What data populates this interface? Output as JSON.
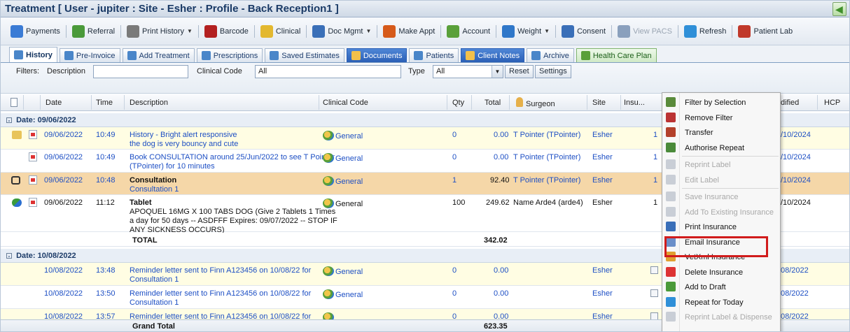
{
  "window": {
    "title": "Treatment [ User - jupiter : Site - Esher : Profile - Back Reception1 ]"
  },
  "toolbar": {
    "items": [
      {
        "label": "Payments",
        "icon": "payments-icon",
        "color": "#3a7bd5",
        "dropdown": false,
        "disabled": false
      },
      {
        "label": "Referral",
        "icon": "referral-icon",
        "color": "#4a9a3a",
        "dropdown": false,
        "disabled": false
      },
      {
        "label": "Print History",
        "icon": "print-history-icon",
        "color": "#7a7a7a",
        "dropdown": true,
        "disabled": false
      },
      {
        "label": "Barcode",
        "icon": "barcode-icon",
        "color": "#b32020",
        "dropdown": false,
        "disabled": false
      },
      {
        "label": "Clinical",
        "icon": "clinical-icon",
        "color": "#e3b82f",
        "dropdown": false,
        "disabled": false
      },
      {
        "label": "Doc Mgmt",
        "icon": "doc-mgmt-icon",
        "color": "#3a6fb8",
        "dropdown": true,
        "disabled": false
      },
      {
        "label": "Make Appt",
        "icon": "calendar-icon",
        "color": "#d65a1a",
        "dropdown": false,
        "disabled": false
      },
      {
        "label": "Account",
        "icon": "account-icon",
        "color": "#5aa03a",
        "dropdown": false,
        "disabled": false
      },
      {
        "label": "Weight",
        "icon": "weight-chart-icon",
        "color": "#2f77c9",
        "dropdown": true,
        "disabled": false
      },
      {
        "label": "Consent",
        "icon": "consent-icon",
        "color": "#3a6fb8",
        "dropdown": false,
        "disabled": false
      },
      {
        "label": "View PACS",
        "icon": "view-pacs-icon",
        "color": "#8aa0bd",
        "dropdown": false,
        "disabled": true
      },
      {
        "label": "Refresh",
        "icon": "refresh-icon",
        "color": "#2f8fd8",
        "dropdown": false,
        "disabled": false
      },
      {
        "label": "Patient Lab",
        "icon": "patient-lab-icon",
        "color": "#c0392b",
        "dropdown": false,
        "disabled": false
      }
    ]
  },
  "tabs": [
    {
      "label": "History",
      "style": "active",
      "icon": "history-tab-icon"
    },
    {
      "label": "Pre-Invoice",
      "style": "normal",
      "icon": "pre-invoice-tab-icon"
    },
    {
      "label": "Add Treatment",
      "style": "normal",
      "icon": "add-treatment-tab-icon"
    },
    {
      "label": "Prescriptions",
      "style": "normal",
      "icon": "prescriptions-tab-icon"
    },
    {
      "label": "Saved Estimates",
      "style": "normal",
      "icon": "saved-estimates-tab-icon"
    },
    {
      "label": "Documents",
      "style": "blue",
      "icon": "documents-tab-icon"
    },
    {
      "label": "Patients",
      "style": "normal",
      "icon": "patients-tab-icon"
    },
    {
      "label": "Client Notes",
      "style": "blue",
      "icon": "client-notes-tab-icon"
    },
    {
      "label": "Archive",
      "style": "normal",
      "icon": "archive-tab-icon"
    },
    {
      "label": "Health Care Plan",
      "style": "green",
      "icon": "health-care-plan-tab-icon"
    }
  ],
  "filters": {
    "label": "Filters:",
    "description_label": "Description",
    "description_value": "",
    "clinical_code_label": "Clinical Code",
    "clinical_code_value": "All",
    "type_label": "Type",
    "type_value": "All",
    "reset_label": "Reset",
    "settings_label": "Settings"
  },
  "columns": {
    "date": "Date",
    "time": "Time",
    "description": "Description",
    "clinical_code": "Clinical Code",
    "qty": "Qty",
    "total": "Total",
    "surgeon": "Surgeon",
    "site": "Site",
    "insurance": "Insu...",
    "modified": "dified",
    "hcp": "HCP"
  },
  "groups": [
    {
      "label": "Date: 09/06/2022",
      "rows": [
        {
          "date": "09/06/2022",
          "time": "10:49",
          "desc1": "History - Bright alert responsive",
          "desc2": "the dog is very bouncy and cute",
          "desc3": "",
          "desc4": "",
          "code": "General",
          "qty": "0",
          "total": "0.00",
          "surgeon": "T Pointer (TPointer)",
          "site": "Esher",
          "ins": "1",
          "mod": "/10/2024"
        },
        {
          "date": "09/06/2022",
          "time": "10:49",
          "desc1": "Book CONSULTATION around 25/Jun/2022 to see T Pointer",
          "desc2": "(TPointer) for 10 minutes",
          "desc3": "",
          "desc4": "",
          "code": "General",
          "qty": "0",
          "total": "0.00",
          "surgeon": "T Pointer (TPointer)",
          "site": "Esher",
          "ins": "1",
          "mod": "/10/2024"
        },
        {
          "date": "09/06/2022",
          "time": "10:48",
          "desc1": "Consultation",
          "desc2": "Consultation 1",
          "desc3": "",
          "desc4": "",
          "code": "General",
          "qty": "1",
          "total": "92.40",
          "surgeon": "T Pointer (TPointer)",
          "site": "Esher",
          "ins": "1",
          "mod": "/10/2024"
        },
        {
          "date": "09/06/2022",
          "time": "11:12",
          "desc1": "Tablet",
          "desc2": "APOQUEL 16MG X 100 TABS DOG (Give 2 Tablets 1 Times",
          "desc3": "a day for 50 days -- ASDFFF Expires: 09/07/2022 -- STOP IF",
          "desc4": "ANY SICKNESS OCCURS)",
          "code": "General",
          "qty": "100",
          "total": "249.62",
          "surgeon": "Name Arde4 (arde4)",
          "site": "Esher",
          "ins": "1",
          "mod": "/10/2024"
        }
      ],
      "total_label": "TOTAL",
      "total_value": "342.02"
    },
    {
      "label": "Date: 10/08/2022",
      "rows": [
        {
          "date": "10/08/2022",
          "time": "13:48",
          "desc1": "Reminder letter sent to Finn A123456 on 10/08/22 for",
          "desc2": "Consultation 1",
          "code": "General",
          "qty": "0",
          "total": "0.00",
          "site": "Esher",
          "mod": "08/2022"
        },
        {
          "date": "10/08/2022",
          "time": "13:50",
          "desc1": "Reminder letter sent to Finn A123456 on 10/08/22 for",
          "desc2": "Consultation 1",
          "code": "General",
          "qty": "0",
          "total": "0.00",
          "site": "Esher",
          "mod": "08/2022"
        },
        {
          "date": "10/08/2022",
          "time": "13:57",
          "desc1": "Reminder letter sent to Finn A123456 on 10/08/22 for",
          "desc2": "",
          "code": "",
          "qty": "0",
          "total": "0.00",
          "site": "Esher",
          "mod": "08/2022"
        }
      ]
    }
  ],
  "grand_total": {
    "label": "Grand Total",
    "value": "623.35"
  },
  "context_menu": [
    {
      "label": "Filter by Selection",
      "icon": "filter-selection-icon",
      "color": "#5a8a3a",
      "disabled": false
    },
    {
      "label": "Remove Filter",
      "icon": "remove-filter-icon",
      "color": "#b33",
      "disabled": false
    },
    {
      "label": "Transfer",
      "icon": "transfer-icon",
      "color": "#b3402a",
      "disabled": false
    },
    {
      "label": "Authorise Repeat",
      "icon": "authorise-repeat-icon",
      "color": "#4a8a3a",
      "disabled": false
    },
    {
      "label": "Reprint Label",
      "icon": "reprint-label-icon",
      "color": "#c9ced6",
      "disabled": true
    },
    {
      "label": "Edit Label",
      "icon": "edit-label-icon",
      "color": "#c9ced6",
      "disabled": true
    },
    {
      "label": "Save Insurance",
      "icon": "save-insurance-icon",
      "color": "#c9ced6",
      "disabled": true
    },
    {
      "label": "Add To Existing Insurance",
      "icon": "add-existing-insurance-icon",
      "color": "#c9ced6",
      "disabled": true
    },
    {
      "label": "Print Insurance",
      "icon": "print-insurance-icon",
      "color": "#3a6fb8",
      "disabled": false
    },
    {
      "label": "Email Insurance",
      "icon": "email-insurance-icon",
      "color": "#6b8fc9",
      "disabled": false
    },
    {
      "label": "VetXml Insurance",
      "icon": "vetxml-insurance-icon",
      "color": "#e0a030",
      "disabled": false
    },
    {
      "label": "Delete Insurance",
      "icon": "delete-insurance-icon",
      "color": "#d33",
      "disabled": false
    },
    {
      "label": "Add to Draft",
      "icon": "add-to-draft-icon",
      "color": "#4a9a3a",
      "disabled": false
    },
    {
      "label": "Repeat for Today",
      "icon": "repeat-today-icon",
      "color": "#2f8fd8",
      "disabled": false
    },
    {
      "label": "Reprint Label & Dispense",
      "icon": "reprint-dispense-icon",
      "color": "#c9ced6",
      "disabled": true
    }
  ],
  "colors": {
    "highlight": "#d11c1c",
    "selected_row": "#f5d7a8",
    "yellow_row": "#fffde3",
    "link": "#1d4fc4"
  }
}
